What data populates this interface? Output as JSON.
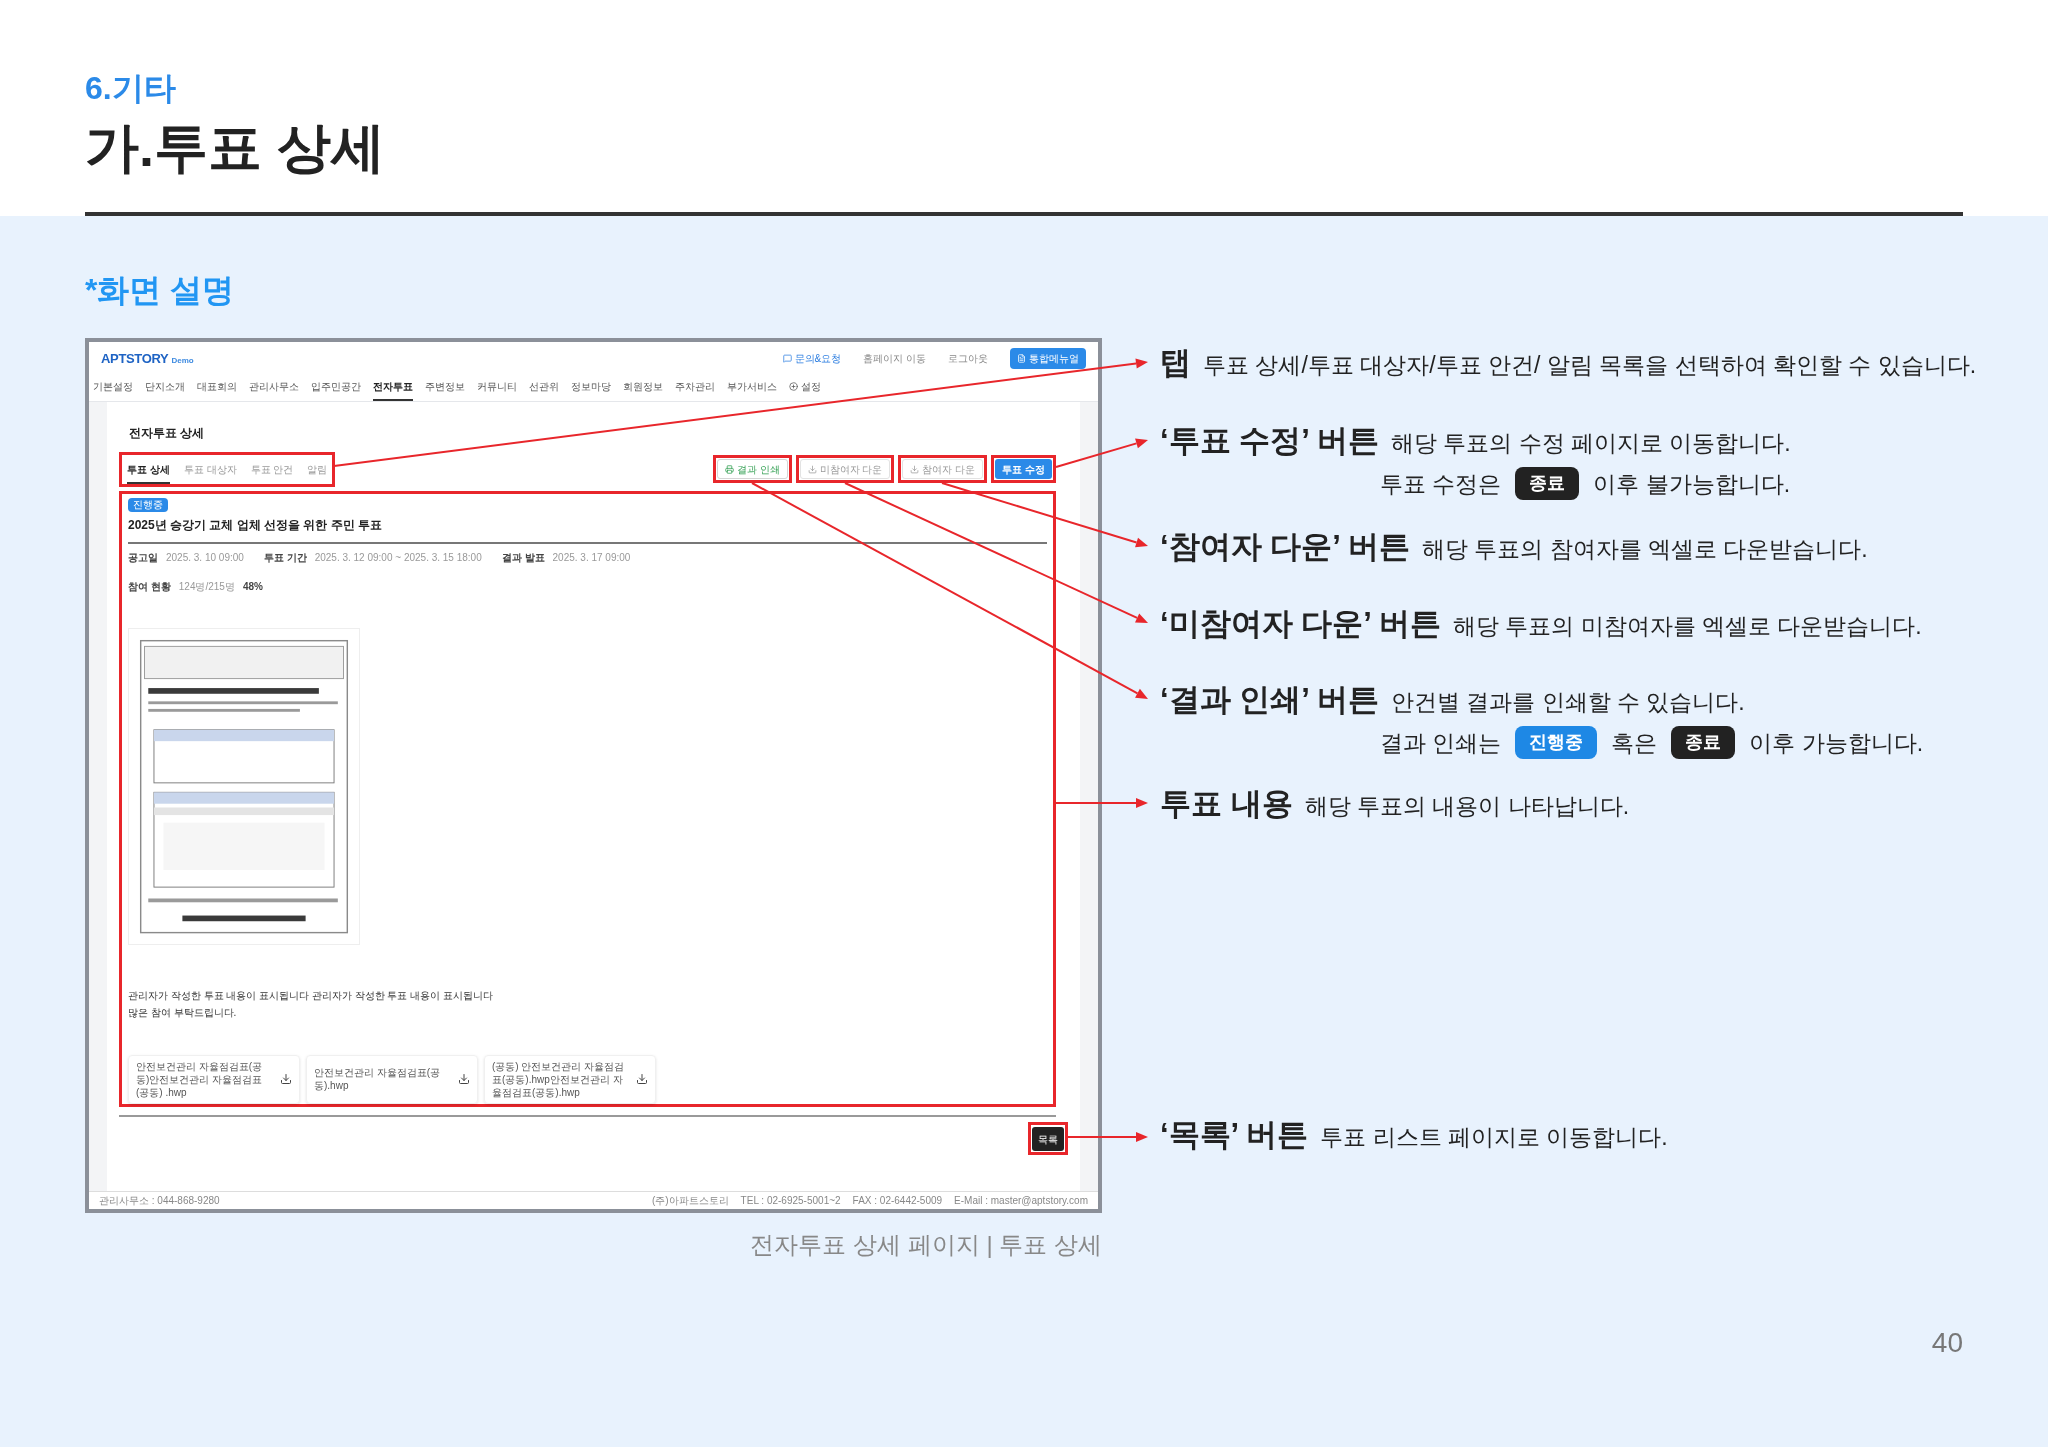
{
  "section": "6.기타",
  "title": "가.투표 상세",
  "subtitle": "*화면 설명",
  "screen": {
    "logo": "APTSTORY",
    "logo_tag": "Demo",
    "top_links": [
      {
        "label": "문의&요청",
        "kind": "chat"
      },
      {
        "label": "홈페이지 이동",
        "kind": "plain"
      },
      {
        "label": "로그아웃",
        "kind": "plain"
      }
    ],
    "top_button": "통합메뉴얼",
    "nav": [
      {
        "label": "기본설정",
        "selected": false,
        "kind": "plain"
      },
      {
        "label": "단지소개",
        "selected": false,
        "kind": "plain"
      },
      {
        "label": "대표회의",
        "selected": false,
        "kind": "plain"
      },
      {
        "label": "관리사무소",
        "selected": false,
        "kind": "plain"
      },
      {
        "label": "입주민공간",
        "selected": false,
        "kind": "plain"
      },
      {
        "label": "전자투표",
        "selected": true,
        "kind": "plain"
      },
      {
        "label": "주변정보",
        "selected": false,
        "kind": "plain"
      },
      {
        "label": "커뮤니티",
        "selected": false,
        "kind": "plain"
      },
      {
        "label": "선관위",
        "selected": false,
        "kind": "plain"
      },
      {
        "label": "정보마당",
        "selected": false,
        "kind": "plain"
      },
      {
        "label": "회원정보",
        "selected": false,
        "kind": "plain"
      },
      {
        "label": "주차관리",
        "selected": false,
        "kind": "plain"
      },
      {
        "label": "부가서비스",
        "selected": false,
        "kind": "plain"
      },
      {
        "label": "설정",
        "selected": false,
        "kind": "settings"
      }
    ],
    "page_title": "전자투표 상세",
    "tabs": [
      {
        "label": "투표 상세",
        "selected": true
      },
      {
        "label": "투표 대상자",
        "selected": false
      },
      {
        "label": "투표 안건",
        "selected": false
      },
      {
        "label": "알림",
        "selected": false
      }
    ],
    "actions": [
      {
        "label": "결과 인쇄",
        "kind": "print"
      },
      {
        "label": "미참여자 다운",
        "kind": "download"
      },
      {
        "label": "참여자 다운",
        "kind": "download"
      },
      {
        "label": "투표 수정",
        "kind": "primary"
      }
    ],
    "status_badge": "진행중",
    "vote_title": "2025년 승강기 교체 업체 선정을 위한 주민 투표",
    "meta": [
      {
        "label": "공고일",
        "value": "2025. 3. 10 09:00"
      },
      {
        "label": "투표 기간",
        "value": "2025. 3. 12 09:00 ~ 2025. 3. 15 18:00"
      },
      {
        "label": "결과 발표",
        "value": "2025. 3. 17 09:00"
      }
    ],
    "participation": {
      "label": "참여 현황",
      "value": "124명/215명",
      "percent": "48%"
    },
    "body": [
      "관리자가 작성한 투표 내용이 표시됩니다 관리자가 작성한 투표 내용이 표시됩니다",
      "많은 참여 부탁드립니다."
    ],
    "files": [
      "안전보건관리 자율점검표(공동)안전보건관리 자율점검표(공동) .hwp",
      "안전보건관리 자율점검표(공동).hwp",
      "(공동) 안전보건관리 자율점검표(공동).hwp안전보건관리 자율점검표(공동).hwp"
    ],
    "list_button": "목록",
    "footer_left": "관리사무소 : 044-868-9280",
    "footer_right": [
      "(주)아파트스토리",
      "TEL : 02-6925-5001~2",
      "FAX : 02-6442-5009",
      "E-Mail : master@aptstory.com"
    ]
  },
  "caption": "전자투표 상세 페이지 | 투표 상세",
  "annotations": [
    {
      "title": "탭",
      "text": "투표 상세/투표 대상자/투표 안건/ 알림 목록을 선택하여 확인할 수 있습니다."
    },
    {
      "title": "‘투표 수정’ 버튼",
      "text": "해당 투표의 수정 페이지로 이동합니다.",
      "note": [
        {
          "kind": "text",
          "text": "투표 수정은"
        },
        {
          "kind": "badge",
          "text": "종료",
          "color": "#222222"
        },
        {
          "kind": "text",
          "text": "이후 불가능합니다."
        }
      ]
    },
    {
      "title": "‘참여자 다운’ 버튼",
      "text": "해당 투표의 참여자를 엑셀로 다운받습니다."
    },
    {
      "title": "‘미참여자 다운’ 버튼",
      "text": "해당 투표의 미참여자를 엑셀로 다운받습니다."
    },
    {
      "title": "‘결과 인쇄’ 버튼",
      "text": "안건별 결과를 인쇄할 수 있습니다.",
      "note": [
        {
          "kind": "text",
          "text": "결과 인쇄는"
        },
        {
          "kind": "badge",
          "text": "진행중",
          "color": "#1e88e5"
        },
        {
          "kind": "text",
          "text": "혹은"
        },
        {
          "kind": "badge",
          "text": "종료",
          "color": "#222222"
        },
        {
          "kind": "text",
          "text": "이후 가능합니다."
        }
      ]
    },
    {
      "title": "투표 내용",
      "text": "해당 투표의 내용이 나타납니다."
    },
    {
      "title": "‘목록’ 버튼",
      "text": "투표 리스트 페이지로 이동합니다."
    }
  ],
  "page_number": "40"
}
